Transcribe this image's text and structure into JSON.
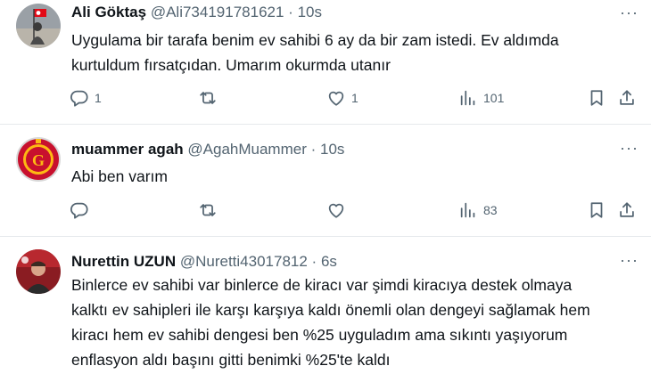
{
  "tweets": [
    {
      "name": "Ali Göktaş",
      "handle": "@Ali734191781621",
      "dot": "·",
      "time": "10s",
      "more": "···",
      "body_lines": [
        "Uygulama bir tarafa benim ev sahibi 6 ay da bir zam istedi. Ev aldımda",
        "kurtuldum fırsatçıdan. Umarım okurmda utanır"
      ],
      "reply_count": "1",
      "retweet_count": "",
      "like_count": "1",
      "view_count": "101"
    },
    {
      "name": "muammer agah",
      "handle": "@AgahMuammer",
      "dot": "·",
      "time": "10s",
      "more": "···",
      "body_lines": [
        "Abi ben varım"
      ],
      "reply_count": "",
      "retweet_count": "",
      "like_count": "",
      "view_count": "83"
    },
    {
      "name": "Nurettin UZUN",
      "handle": "@Nuretti43017812",
      "dot": "·",
      "time": "6s",
      "more": "···",
      "body_lines": [
        "Binlerce ev sahibi var binlerce de kiracı var şimdi kiracıya destek olmaya",
        "kalktı ev sahipleri ile karşı karşıya kaldı önemli olan dengeyi sağlamak hem",
        "kiracı hem ev sahibi dengesi ben %25 uyguladım ama sıkıntı yaşıyorum",
        "enflasyon aldı başını gitti benimki %25'te kaldı"
      ]
    }
  ],
  "icons": {
    "reply": "reply-icon",
    "retweet": "retweet-icon",
    "like": "heart-icon",
    "views": "views-icon",
    "bookmark": "bookmark-icon",
    "share": "share-icon"
  },
  "colors": {
    "text": "#0f1419",
    "secondary": "#536471",
    "divider": "#e6e9ec",
    "galatasaray_red": "#c8102e",
    "galatasaray_yellow": "#fdb913"
  }
}
